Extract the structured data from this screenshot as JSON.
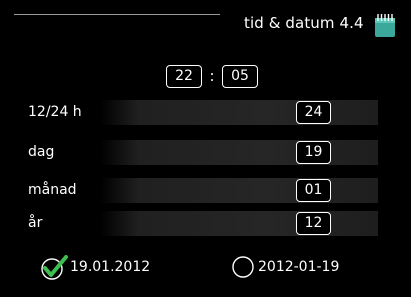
{
  "header": {
    "title": "tid & datum 4.4",
    "icon": "calendar-icon"
  },
  "time": {
    "hour": "22",
    "separator": ":",
    "minute": "05"
  },
  "settings": [
    {
      "label": "12/24 h",
      "value": "24"
    },
    {
      "label": "dag",
      "value": "19"
    },
    {
      "label": "månad",
      "value": "01"
    },
    {
      "label": "år",
      "value": "12"
    }
  ],
  "date_formats": [
    {
      "label": "19.01.2012",
      "selected": true,
      "icon": "checkmark-icon"
    },
    {
      "label": "2012-01-19",
      "selected": false,
      "icon": "radio-unselected-icon"
    }
  ],
  "colors": {
    "background": "#000000",
    "text": "#ffffff",
    "check_green": "#3fbf4f",
    "icon_teal": "#3aa89a"
  }
}
